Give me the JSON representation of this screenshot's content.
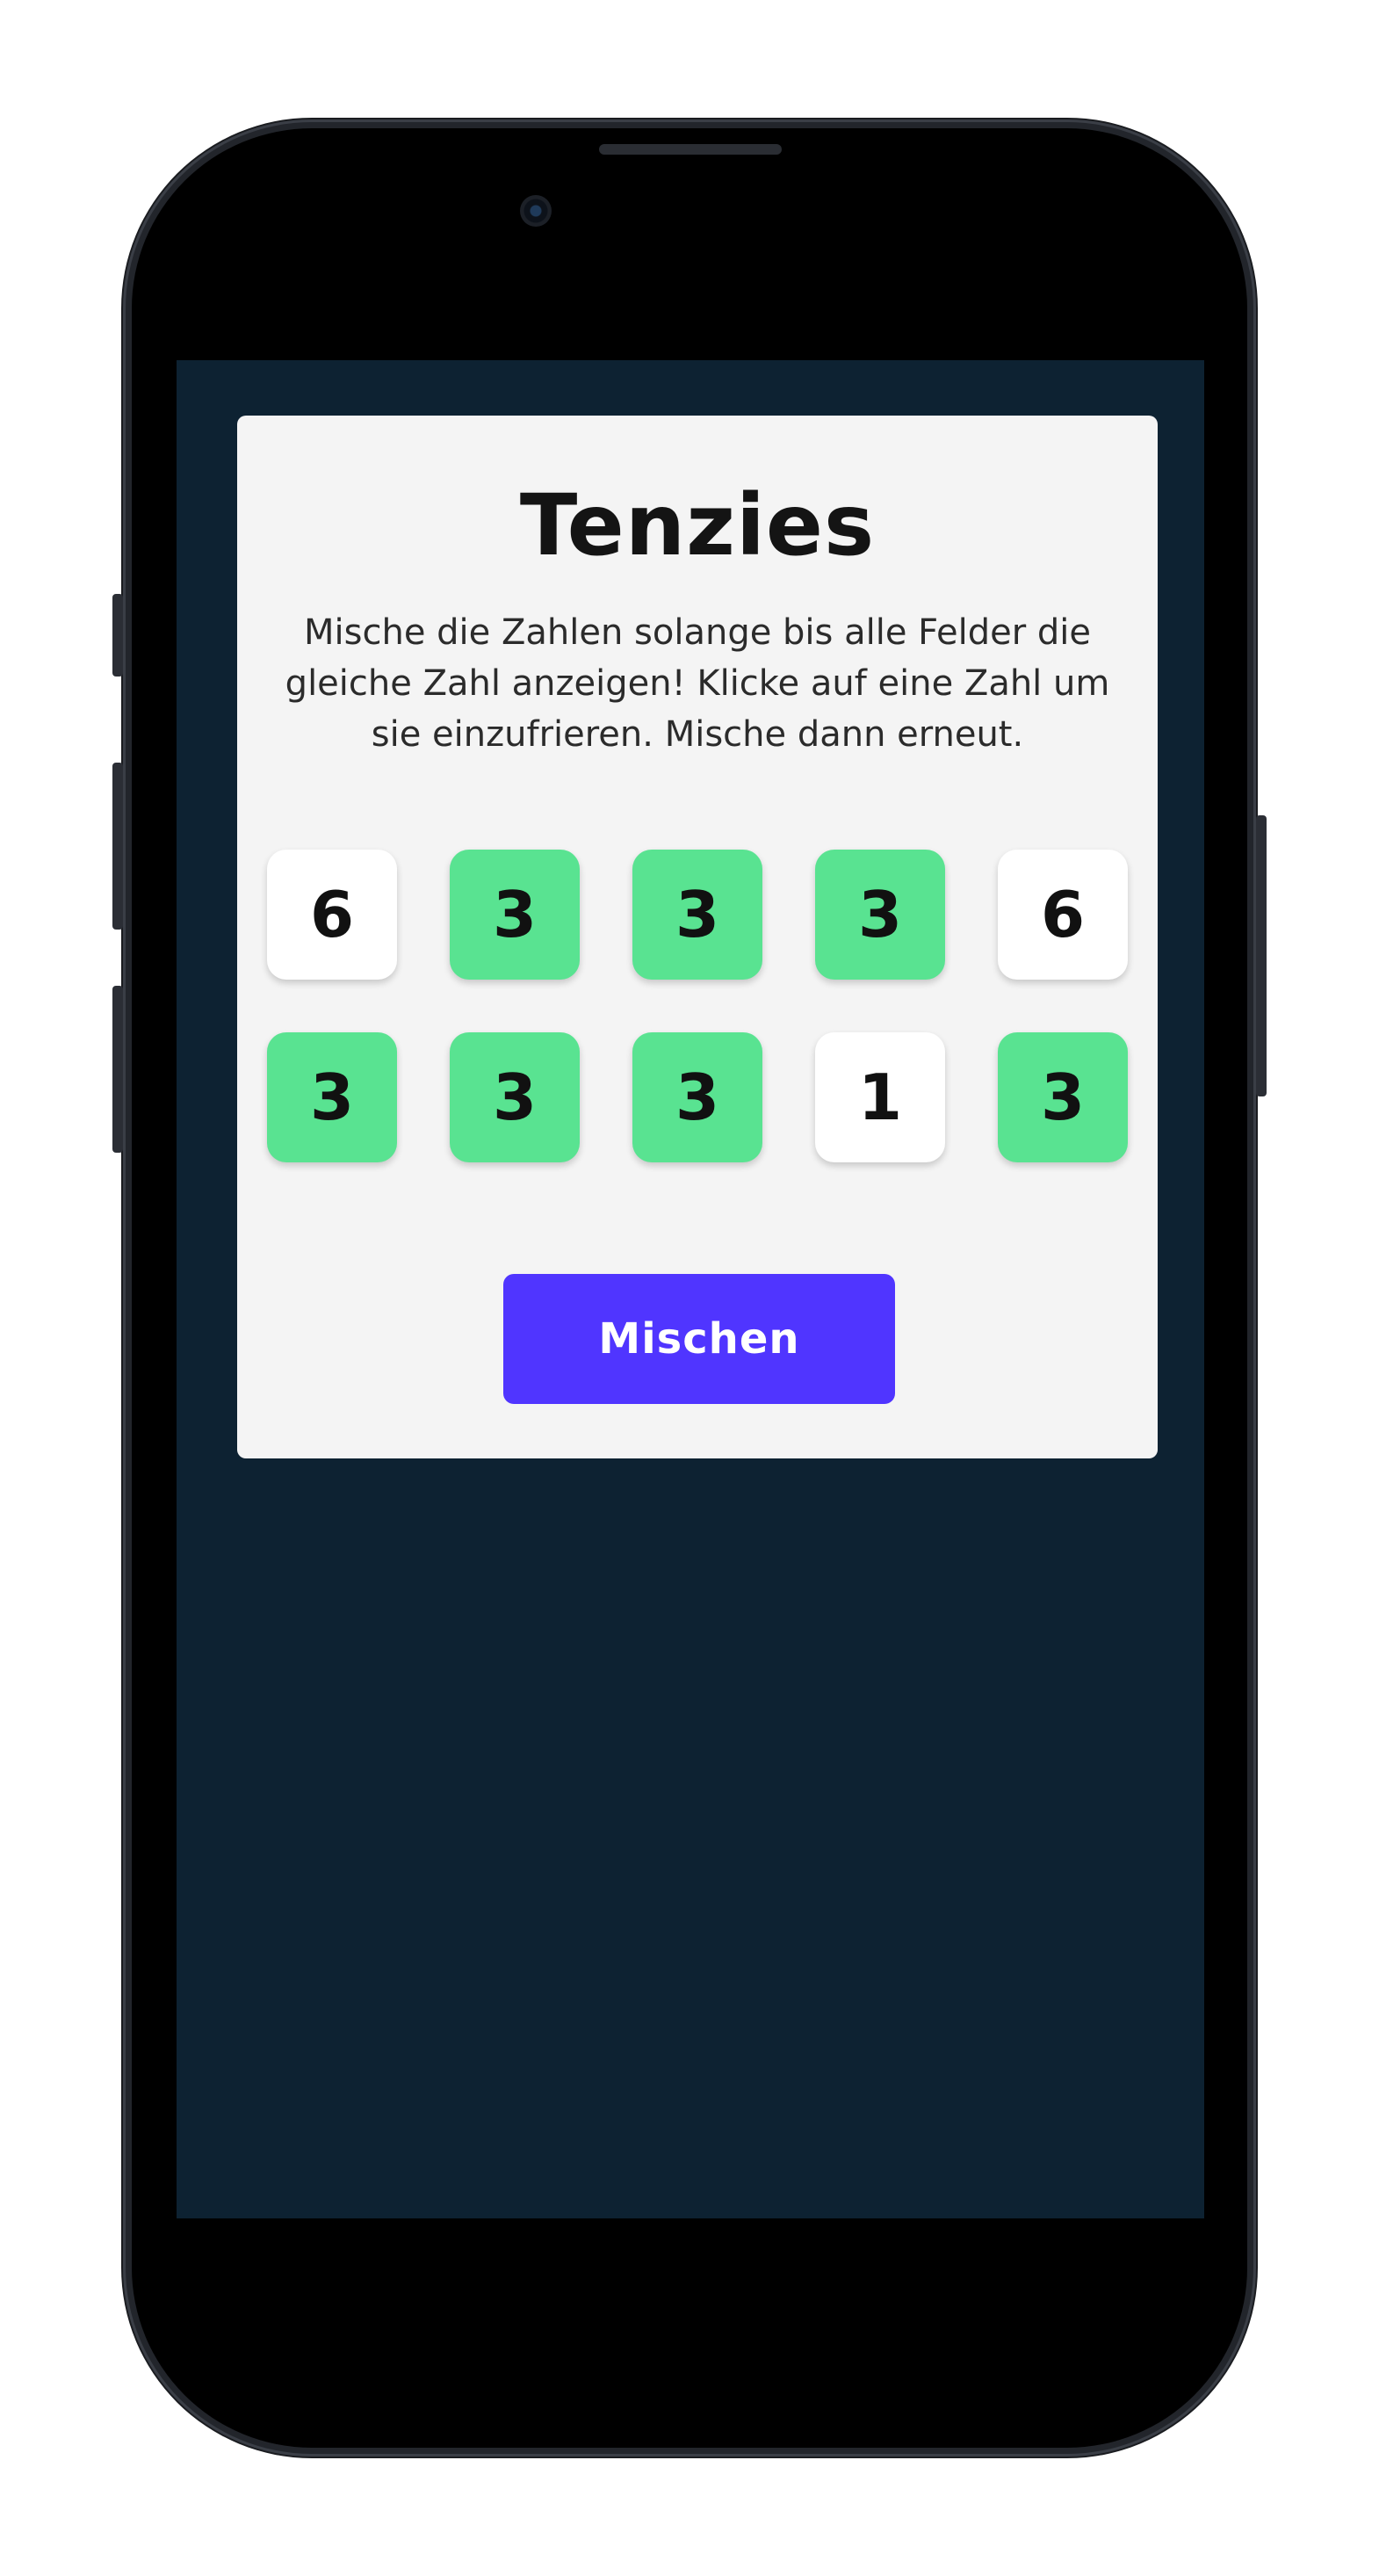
{
  "app": {
    "title": "Tenzies",
    "instructions": "Mische die Zahlen solange bis alle Felder die gleiche Zahl anzeigen! Klicke auf eine Zahl um sie einzufrieren. Mische dann erneut.",
    "roll_button_label": "Mischen"
  },
  "dice": [
    {
      "value": "6",
      "held": false
    },
    {
      "value": "3",
      "held": true
    },
    {
      "value": "3",
      "held": true
    },
    {
      "value": "3",
      "held": true
    },
    {
      "value": "6",
      "held": false
    },
    {
      "value": "3",
      "held": true
    },
    {
      "value": "3",
      "held": true
    },
    {
      "value": "3",
      "held": true
    },
    {
      "value": "1",
      "held": false
    },
    {
      "value": "3",
      "held": true
    }
  ],
  "colors": {
    "screen_background": "#0d2232",
    "card_background": "#f4f4f4",
    "held_die": "#59e391",
    "free_die": "#ffffff",
    "button": "#5035ff"
  },
  "icons": {
    "camera": "front-camera-icon"
  }
}
